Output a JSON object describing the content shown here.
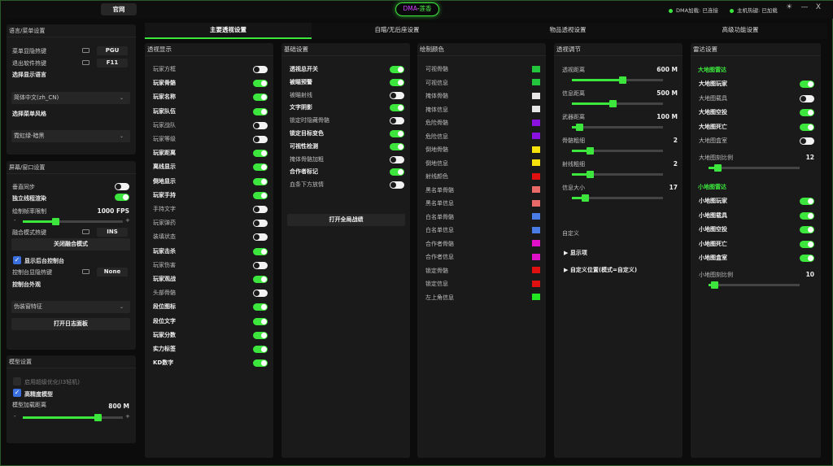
{
  "topbar": {
    "official_btn": "官网",
    "brand_a": "DMA",
    "brand_b": "-",
    "brand_c": "莲香",
    "dma_status": "DMA加载: 已连接",
    "host_status": "主机热键: 已加载",
    "theme_icon": "☀",
    "min": "—",
    "close": "X"
  },
  "colors": {
    "accent": "#3ce63c",
    "toggle_off": "#f2f2f2",
    "panel": "#1a1a1a",
    "check": "#3a6fe0"
  },
  "lang": {
    "title": "语言/菜单设置",
    "menu_hotkey": "菜单显隐热键",
    "menu_hotkey_val": "PGU",
    "exit_hotkey": "退出软件热键",
    "exit_hotkey_val": "F11",
    "select_lang": "选择显示语言",
    "lang_value": "简体中文(zh_CN)",
    "select_style": "选择菜单风格",
    "style_value": "霓虹绿-暗黑"
  },
  "screen": {
    "title": "屏幕/窗口设置",
    "vsync": "垂直同步",
    "independent": "独立线程渲染",
    "fps_label": "绘制帧率限制",
    "fps_value": "1000 FPS",
    "fusion_hotkey": "融合模式热键",
    "fusion_val": "INS",
    "fusion_btn": "关闭融合模式",
    "bg_console": "显示后台控制台",
    "console_hotkey": "控制台显隐热键",
    "console_val": "None",
    "console_look": "控制台外观",
    "feature_value": "伪装窗特征",
    "log_btn": "打开日志面板"
  },
  "model": {
    "title": "模型设置",
    "super_opt": "启用超级优化(I3轻机)",
    "hires": "高精度模型",
    "dist_label": "模型加载距离",
    "dist_value": "800 M"
  },
  "tabs": [
    "主要透视设置",
    "自瞄/无后座设置",
    "物品透视设置",
    "高级功能设置"
  ],
  "col1": {
    "title": "透视显示",
    "items": [
      {
        "l": "玩家方框",
        "on": false,
        "b": false
      },
      {
        "l": "玩家骨骼",
        "on": true,
        "b": true
      },
      {
        "l": "玩家名称",
        "on": true,
        "b": true
      },
      {
        "l": "玩家队伍",
        "on": true,
        "b": true
      },
      {
        "l": "玩家战队",
        "on": false,
        "b": false
      },
      {
        "l": "玩家等级",
        "on": false,
        "b": false
      },
      {
        "l": "玩家距离",
        "on": true,
        "b": true
      },
      {
        "l": "离线显示",
        "on": true,
        "b": true
      },
      {
        "l": "倒地显示",
        "on": true,
        "b": true
      },
      {
        "l": "玩家手持",
        "on": true,
        "b": true
      },
      {
        "l": "手持文字",
        "on": false,
        "b": false
      },
      {
        "l": "玩家弹药",
        "on": false,
        "b": false
      },
      {
        "l": "装填状态",
        "on": false,
        "b": false
      },
      {
        "l": "玩家击杀",
        "on": true,
        "b": true
      },
      {
        "l": "玩家伤害",
        "on": false,
        "b": false
      },
      {
        "l": "玩家观战",
        "on": true,
        "b": true
      },
      {
        "l": "头部骨骼",
        "on": false,
        "b": false
      },
      {
        "l": "段位图标",
        "on": true,
        "b": true
      },
      {
        "l": "段位文字",
        "on": true,
        "b": true
      },
      {
        "l": "玩家分数",
        "on": true,
        "b": true
      },
      {
        "l": "实力标签",
        "on": true,
        "b": true
      },
      {
        "l": "KD数字",
        "on": true,
        "b": true
      }
    ]
  },
  "col2": {
    "title": "基础设置",
    "items": [
      {
        "l": "透视总开关",
        "on": true,
        "b": true
      },
      {
        "l": "被瞄预警",
        "on": true,
        "b": true
      },
      {
        "l": "被瞄射线",
        "on": false,
        "b": false
      },
      {
        "l": "文字阴影",
        "on": true,
        "b": true
      },
      {
        "l": "锁定时隐藏骨骼",
        "on": false,
        "b": false
      },
      {
        "l": "锁定目标变色",
        "on": true,
        "b": true
      },
      {
        "l": "可视性检测",
        "on": true,
        "b": true
      },
      {
        "l": "掩体骨骼加粗",
        "on": false,
        "b": false
      },
      {
        "l": "合作者标记",
        "on": true,
        "b": true
      },
      {
        "l": "血条下方放情",
        "on": false,
        "b": false
      }
    ],
    "battle_btn": "打开全局战绩"
  },
  "col3": {
    "title": "绘制颜色",
    "items": [
      {
        "l": "可视骨骼",
        "c": "#22c53c"
      },
      {
        "l": "可视信息",
        "c": "#22c53c"
      },
      {
        "l": "掩体骨骼",
        "c": "#e6e6e6"
      },
      {
        "l": "掩体信息",
        "c": "#e6e6e6"
      },
      {
        "l": "危险骨骼",
        "c": "#8a12e0"
      },
      {
        "l": "危险信息",
        "c": "#8a12e0"
      },
      {
        "l": "倒地骨骼",
        "c": "#f5e20a"
      },
      {
        "l": "倒地信息",
        "c": "#f5e20a"
      },
      {
        "l": "射线颜色",
        "c": "#e01010"
      },
      {
        "l": "黑名单骨骼",
        "c": "#ea6a6a"
      },
      {
        "l": "黑名单信息",
        "c": "#ea6a6a"
      },
      {
        "l": "白名单骨骼",
        "c": "#4a7ce6"
      },
      {
        "l": "白名单信息",
        "c": "#4a7ce6"
      },
      {
        "l": "合作者骨骼",
        "c": "#e010c8"
      },
      {
        "l": "合作者信息",
        "c": "#e010c8"
      },
      {
        "l": "锁定骨骼",
        "c": "#e01010"
      },
      {
        "l": "锁定信息",
        "c": "#e01010"
      },
      {
        "l": "左上角信息",
        "c": "#22e622"
      }
    ]
  },
  "col4": {
    "title": "透视调节",
    "sliders": [
      {
        "l": "透视距离",
        "v": "600 M",
        "p": 0.55
      },
      {
        "l": "信息距离",
        "v": "500 M",
        "p": 0.45
      },
      {
        "l": "武器距离",
        "v": "100 M",
        "p": 0.08
      },
      {
        "l": "骨骼粗细",
        "v": "2",
        "p": 0.2
      },
      {
        "l": "射线粗细",
        "v": "2",
        "p": 0.2
      },
      {
        "l": "信息大小",
        "v": "17",
        "p": 0.14
      }
    ],
    "custom": "自定义",
    "show_items": "显示项",
    "custom_pos": "自定义位置(模式=自定义)"
  },
  "col5": {
    "title": "雷达设置",
    "big_title": "大地图雷达",
    "big": [
      {
        "l": "大地图玩家",
        "on": true
      },
      {
        "l": "大地图载具",
        "on": false
      },
      {
        "l": "大地图空投",
        "on": true
      },
      {
        "l": "大地图死亡",
        "on": true
      },
      {
        "l": "大地图盒室",
        "on": false
      }
    ],
    "big_scale": "大地图刻比例",
    "big_scale_v": "12",
    "big_scale_p": 0.1,
    "mini_title": "小地图雷达",
    "mini": [
      {
        "l": "小地图玩家",
        "on": true
      },
      {
        "l": "小地图载具",
        "on": true
      },
      {
        "l": "小地图空投",
        "on": true
      },
      {
        "l": "小地图死亡",
        "on": true
      },
      {
        "l": "小地图盒室",
        "on": true
      }
    ],
    "mini_scale": "小地图刻比例",
    "mini_scale_v": "10",
    "mini_scale_p": 0.06
  }
}
